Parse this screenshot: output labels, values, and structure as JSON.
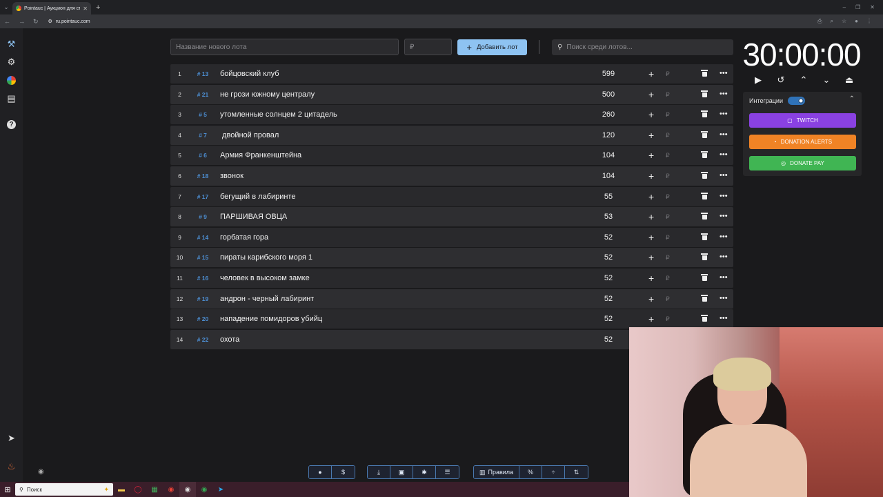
{
  "browser": {
    "tab_title": "Pointauc | Аукцион для стрим",
    "url": "ru.pointauc.com"
  },
  "toolbar_top": {
    "lot_name_placeholder": "Название нового лота",
    "price_placeholder": "₽",
    "add_label": "Добавить лот",
    "search_placeholder": "Поиск среди лотов..."
  },
  "lots": [
    {
      "idx": "1",
      "id": "# 13",
      "name": "бойцовский клуб",
      "amount": "599"
    },
    {
      "idx": "2",
      "id": "# 21",
      "name": "не грози южному централу",
      "amount": "500"
    },
    {
      "idx": "3",
      "id": "# 5",
      "name": "утомленные солнцем 2 цитадель",
      "amount": "260"
    },
    {
      "idx": "4",
      "id": "# 7",
      "name": " двойной провал",
      "amount": "120"
    },
    {
      "idx": "5",
      "id": "# 6",
      "name": "Армия Франкенштейна",
      "amount": "104"
    },
    {
      "idx": "6",
      "id": "# 18",
      "name": "звонок",
      "amount": "104"
    },
    {
      "idx": "7",
      "id": "# 17",
      "name": "бегущий в лабиринте",
      "amount": "55"
    },
    {
      "idx": "8",
      "id": "# 9",
      "name": "ПАРШИВАЯ ОВЦА",
      "amount": "53"
    },
    {
      "idx": "9",
      "id": "# 14",
      "name": "горбатая гора",
      "amount": "52"
    },
    {
      "idx": "10",
      "id": "# 15",
      "name": "пираты карибского моря 1",
      "amount": "52"
    },
    {
      "idx": "11",
      "id": "# 16",
      "name": "человек в высоком замке",
      "amount": "52"
    },
    {
      "idx": "12",
      "id": "# 19",
      "name": "андрон - черный лабиринт",
      "amount": "52"
    },
    {
      "idx": "13",
      "id": "# 20",
      "name": "нападение помидоров убийц",
      "amount": "52"
    },
    {
      "idx": "14",
      "id": "# 22",
      "name": "охота",
      "amount": "52"
    }
  ],
  "lot_row_icons": {
    "plus": "+",
    "currency": "₽",
    "more": "•••"
  },
  "timer": {
    "display": "30:00:00"
  },
  "integrations": {
    "label": "Интеграции",
    "twitch": "TWITCH",
    "donation_alerts": "DONATION ALERTS",
    "donate_pay": "DONATE PAY"
  },
  "bottom_toolbar": {
    "rules_label": "Правила"
  },
  "taskbar": {
    "search_label": "Поиск"
  },
  "colors": {
    "accent": "#8ec3f2",
    "lot_id": "#4d8fd4",
    "twitch": "#8a41e2",
    "donation_alerts": "#f08325",
    "donate_pay": "#40b553"
  }
}
